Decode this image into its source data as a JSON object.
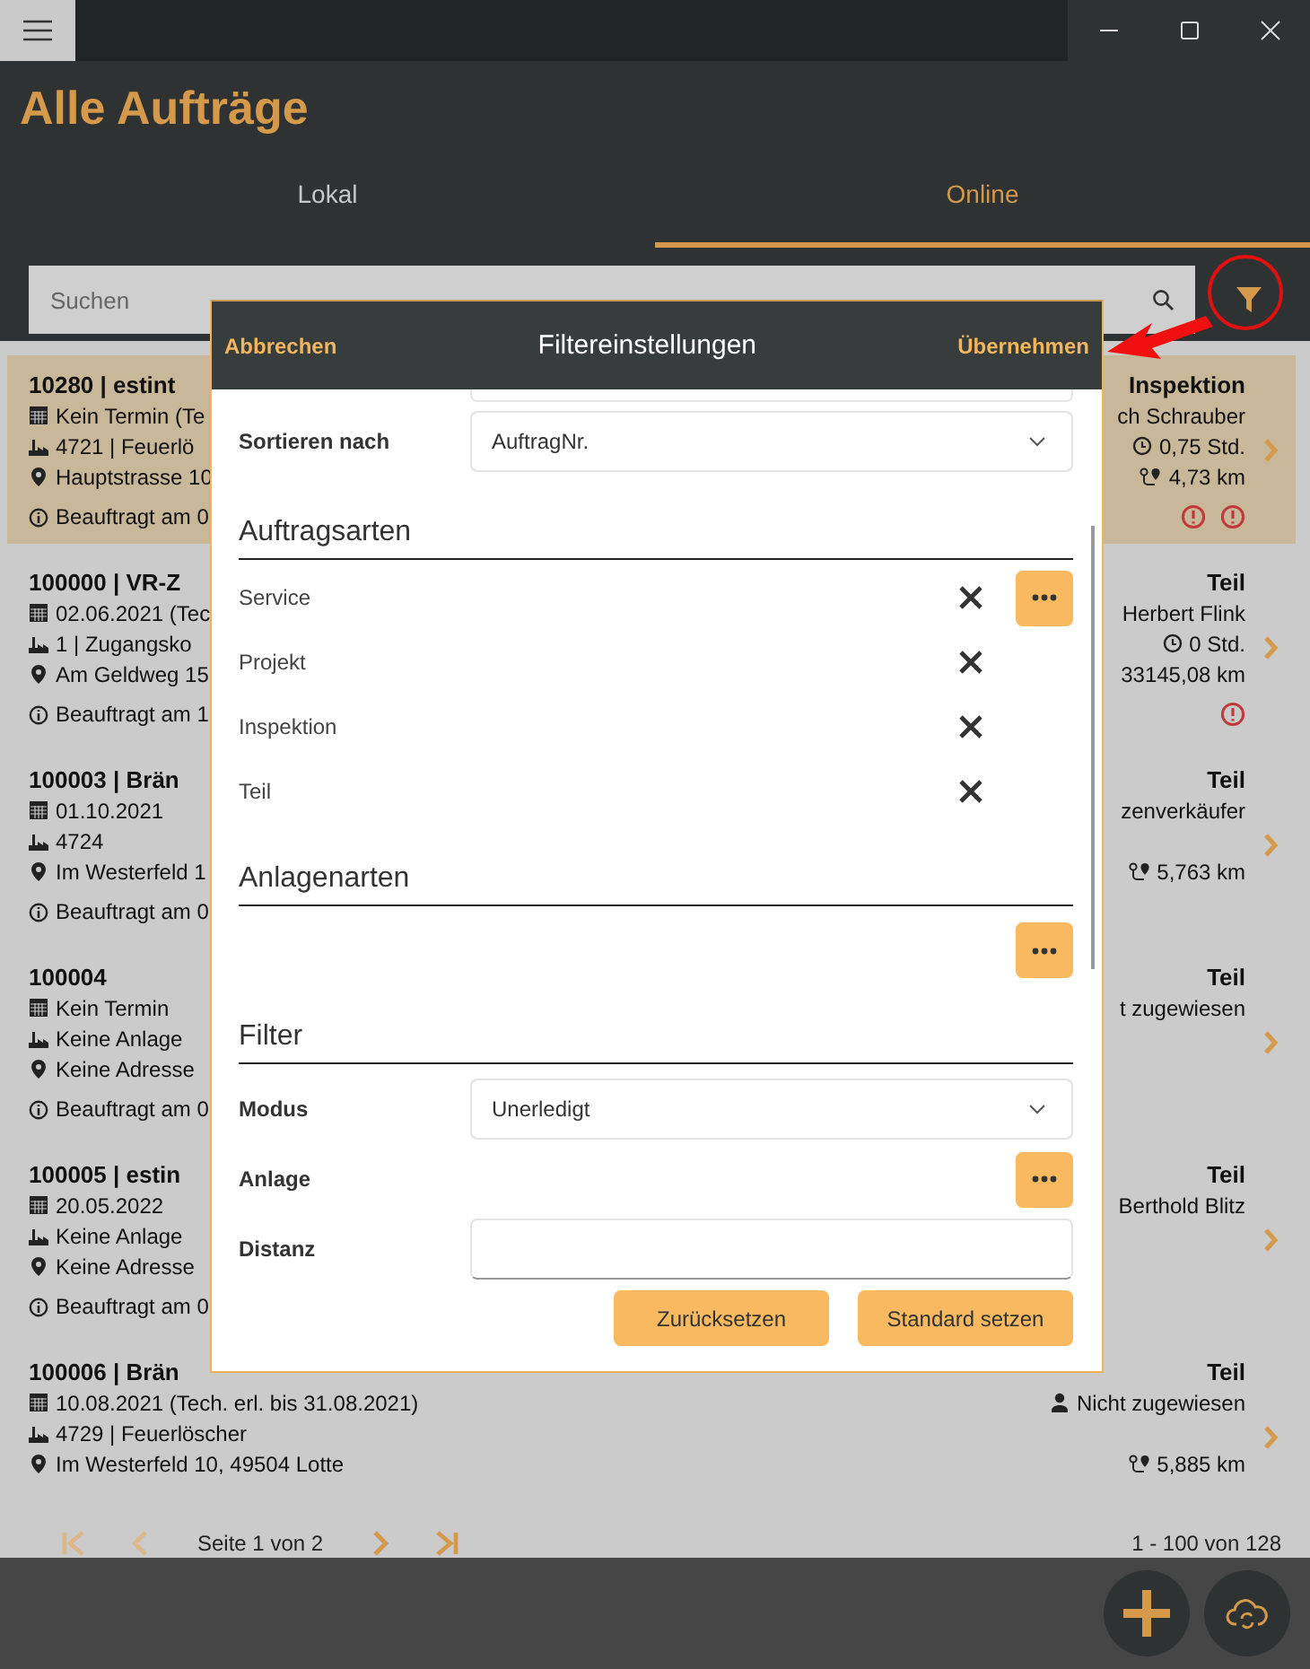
{
  "window": {
    "title": "Alle Aufträge"
  },
  "tabs": [
    {
      "label": "Lokal",
      "selected": false
    },
    {
      "label": "Online",
      "selected": true
    }
  ],
  "search": {
    "placeholder": "Suchen"
  },
  "orders": [
    {
      "selected": true,
      "left": [
        {
          "kind": "title",
          "text": "10280 | estint"
        },
        {
          "kind": "date",
          "text": "Kein Termin (Te"
        },
        {
          "kind": "asset",
          "text": "4721 | Feuerlö"
        },
        {
          "kind": "address",
          "text": "Hauptstrasse 10"
        },
        {
          "kind": "info",
          "text": "Beauftragt am 0"
        }
      ],
      "right": [
        {
          "kind": "type",
          "text": "Inspektion",
          "icon": false
        },
        {
          "kind": "person",
          "text": "ch Schrauber",
          "icon": false
        },
        {
          "kind": "hours",
          "text": "0,75 Std.",
          "icon": true
        },
        {
          "kind": "distance",
          "text": "4,73 km",
          "icon": true
        }
      ],
      "alerts": [
        {
          "kind": "warning"
        },
        {
          "kind": "warning"
        }
      ]
    },
    {
      "selected": false,
      "left": [
        {
          "kind": "title",
          "text": "100000 | VR-Z"
        },
        {
          "kind": "date",
          "text": "02.06.2021 (Tec"
        },
        {
          "kind": "asset",
          "text": "1 | Zugangsko"
        },
        {
          "kind": "address",
          "text": "Am Geldweg 15"
        },
        {
          "kind": "info",
          "text": "Beauftragt am 1"
        }
      ],
      "right": [
        {
          "kind": "type",
          "text": "Teil",
          "icon": false
        },
        {
          "kind": "person",
          "text": "Herbert Flink",
          "icon": false
        },
        {
          "kind": "hours",
          "text": "0 Std.",
          "icon": true
        },
        {
          "kind": "distance",
          "text": "33145,08 km",
          "icon": false
        }
      ],
      "alerts": [
        {
          "kind": "warning"
        }
      ]
    },
    {
      "selected": false,
      "left": [
        {
          "kind": "title",
          "text": "100003 | Brän"
        },
        {
          "kind": "date",
          "text": "01.10.2021"
        },
        {
          "kind": "asset",
          "text": "4724"
        },
        {
          "kind": "address",
          "text": "Im Westerfeld 1"
        },
        {
          "kind": "info",
          "text": "Beauftragt am 0"
        }
      ],
      "right": [
        {
          "kind": "type",
          "text": "Teil",
          "icon": false
        },
        {
          "kind": "person",
          "text": "zenverkäufer",
          "icon": false
        },
        {
          "kind": "distance",
          "text": "5,763 km",
          "icon": true
        }
      ]
    },
    {
      "selected": false,
      "left": [
        {
          "kind": "title",
          "text": "100004"
        },
        {
          "kind": "date",
          "text": "Kein Termin"
        },
        {
          "kind": "asset",
          "text": "Keine Anlage"
        },
        {
          "kind": "address",
          "text": "Keine Adresse"
        },
        {
          "kind": "info",
          "text": "Beauftragt am 0"
        }
      ],
      "right": [
        {
          "kind": "type",
          "text": "Teil",
          "icon": false
        },
        {
          "kind": "person",
          "text": "t zugewiesen",
          "icon": false
        }
      ]
    },
    {
      "selected": false,
      "left": [
        {
          "kind": "title",
          "text": "100005 | estin"
        },
        {
          "kind": "date",
          "text": "20.05.2022"
        },
        {
          "kind": "asset",
          "text": "Keine Anlage"
        },
        {
          "kind": "address",
          "text": "Keine Adresse"
        },
        {
          "kind": "info",
          "text": "Beauftragt am 0"
        }
      ],
      "right": [
        {
          "kind": "type",
          "text": "Teil",
          "icon": false
        },
        {
          "kind": "person",
          "text": "Berthold Blitz",
          "icon": false
        }
      ]
    },
    {
      "selected": false,
      "left": [
        {
          "kind": "title",
          "text": "100006 | Brän"
        },
        {
          "kind": "date",
          "text": "10.08.2021 (Tech. erl. bis 31.08.2021)"
        },
        {
          "kind": "asset",
          "text": "4729 | Feuerlöscher"
        },
        {
          "kind": "address",
          "text": "Im Westerfeld 10, 49504 Lotte"
        }
      ],
      "right": [
        {
          "kind": "type",
          "text": "Teil",
          "icon": false
        },
        {
          "kind": "person",
          "text": "Nicht zugewiesen",
          "icon": true
        },
        {
          "kind": "distance",
          "text": "5,885 km",
          "icon": true
        }
      ]
    }
  ],
  "pager": {
    "label": "Seite 1 von 2",
    "range": "1 - 100 von 128",
    "buttons": [
      {
        "kind": "first",
        "disabled": true
      },
      {
        "kind": "prev",
        "disabled": true
      },
      {
        "kind": "next",
        "disabled": false
      },
      {
        "kind": "last",
        "disabled": false
      }
    ]
  },
  "filter_dialog": {
    "cancel": "Abbrechen",
    "title": "Filtereinstellungen",
    "apply": "Übernehmen",
    "sort": {
      "label": "Sortieren nach",
      "value": "AuftragNr."
    },
    "type_section": {
      "title": "Auftragsarten",
      "items": [
        {
          "label": "Service",
          "more": true
        },
        {
          "label": "Projekt",
          "more": false
        },
        {
          "label": "Inspektion",
          "more": false
        },
        {
          "label": "Teil",
          "more": false
        }
      ]
    },
    "asset_section": {
      "title": "Anlagenarten"
    },
    "filter_section": {
      "title": "Filter",
      "fields": [
        {
          "kind": "select",
          "label": "Modus",
          "value": "Unerledigt"
        },
        {
          "kind": "picker",
          "label": "Anlage"
        },
        {
          "kind": "input",
          "label": "Distanz"
        }
      ]
    },
    "buttons": [
      "Zurücksetzen",
      "Standard setzen"
    ]
  }
}
